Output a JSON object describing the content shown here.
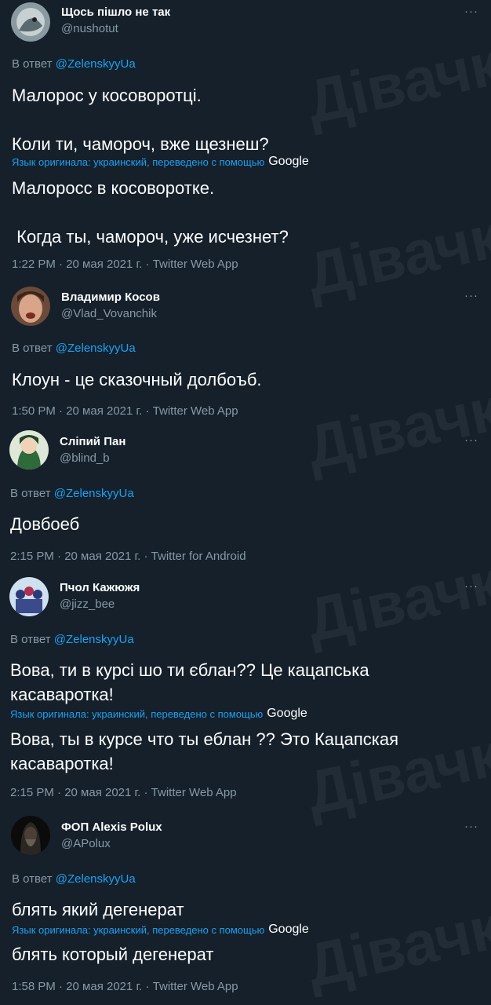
{
  "reply_prefix": "В ответ",
  "reply_target": "@ZelenskyyUa",
  "more_label": "···",
  "translation_label": "Язык оригинала: украинский, переведено с помощью",
  "translation_brand": "Google",
  "tweets": [
    {
      "name": "Щось пішло не так",
      "handle": "@nushotut",
      "text": "Малорос у косоворотці.\n\nКоли ти, чамороч, вже щезнеш?",
      "translation": "Малоросс в косоворотке.\n\n Когда ты, чамороч, уже исчезнет?",
      "meta": "1:22 PM · 20 мая 2021 г. · Twitter Web App"
    },
    {
      "name": "Владимир Косов",
      "handle": "@Vlad_Vovanchik",
      "text": "Клоун - це сказочный долбоъб.",
      "meta": "1:50 PM · 20 мая 2021 г. · Twitter Web App"
    },
    {
      "name": "Сліпий Пан",
      "handle": "@blind_b",
      "text": "Довбоеб",
      "meta": "2:15 PM · 20 мая 2021 г. · Twitter for Android"
    },
    {
      "name": "Пчол Кажюжя",
      "handle": "@jizz_bee",
      "text": "Вова, ти в курсі шо ти єблан?? Це кацапська\nкасаваротка!",
      "translation": "Вова, ты в курсе что ты еблан ?? Это Кацапская\nкасаваротка!",
      "meta": "2:15 PM · 20 мая 2021 г. · Twitter Web App"
    },
    {
      "name": "ФОП Alexis Polux",
      "handle": "@APolux",
      "text": "блять який дегенерат",
      "translation": "блять который дегенерат",
      "meta": "1:58 PM · 20 мая 2021 г. · Twitter Web App"
    }
  ]
}
